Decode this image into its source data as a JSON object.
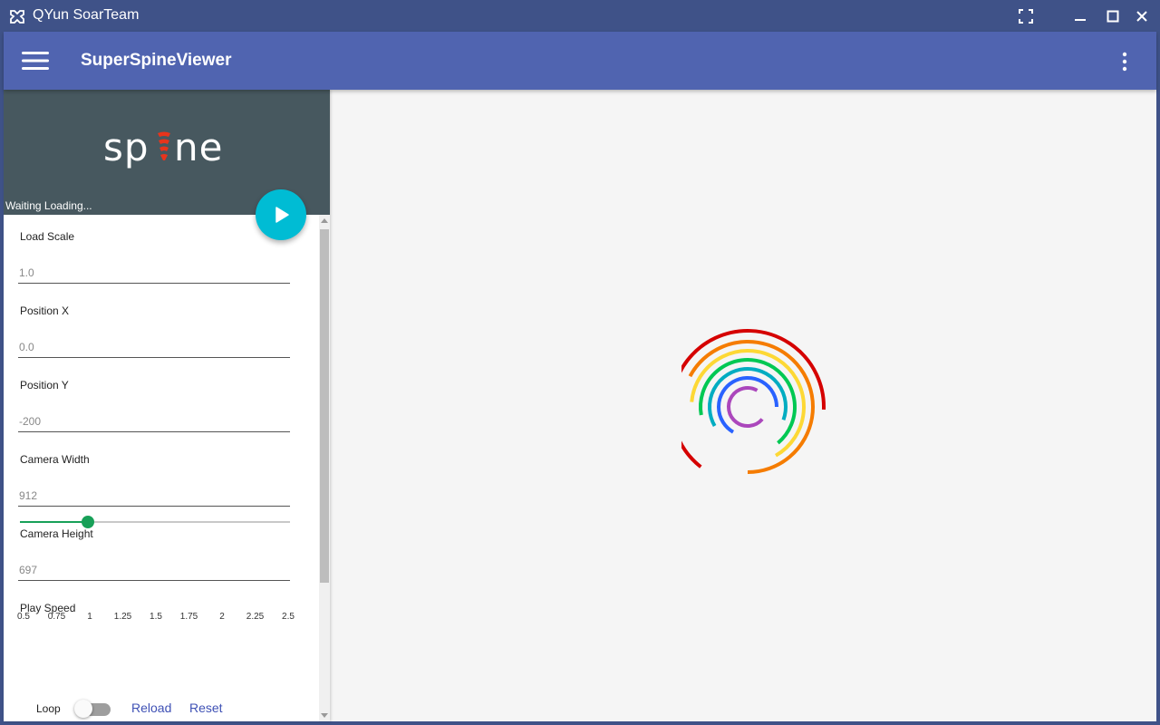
{
  "window": {
    "title": "QYun SoarTeam",
    "icons": [
      "app-icon",
      "fullscreen-icon",
      "minimize-icon",
      "maximize-icon",
      "close-icon"
    ]
  },
  "toolbar": {
    "app_title": "SuperSpineViewer",
    "menu_icon": "hamburger-menu-icon",
    "more_icon": "more-vertical-icon"
  },
  "banner": {
    "logo_text": "spine",
    "status": "Waiting Loading...",
    "play_icon": "play-icon"
  },
  "form": {
    "fields": [
      {
        "label": "Load Scale",
        "value": "1.0"
      },
      {
        "label": "Position X",
        "value": "0.0"
      },
      {
        "label": "Position Y",
        "value": "-200"
      },
      {
        "label": "Camera Width",
        "value": "912"
      },
      {
        "label": "Camera Height",
        "value": "697"
      }
    ],
    "speed": {
      "label": "Play Speed",
      "value": 1,
      "min": 0.5,
      "max": 2.5,
      "ticks": [
        "0.5",
        "0.75",
        "1",
        "1.25",
        "1.5",
        "1.75",
        "2",
        "2.25",
        "2.5"
      ]
    },
    "loop_label": "Loop",
    "loop_on": false,
    "reload_label": "Reload",
    "reset_label": "Reset"
  },
  "colors": {
    "titlebar": "#3f5288",
    "toolbar": "#5064b0",
    "banner": "#47585f",
    "fab": "#00bcd4",
    "slider": "#18a058",
    "link": "#3f51b5",
    "spinner": [
      "#d50000",
      "#f57c00",
      "#fdd835",
      "#00c853",
      "#00acc1",
      "#2962ff",
      "#ab47bc"
    ]
  }
}
